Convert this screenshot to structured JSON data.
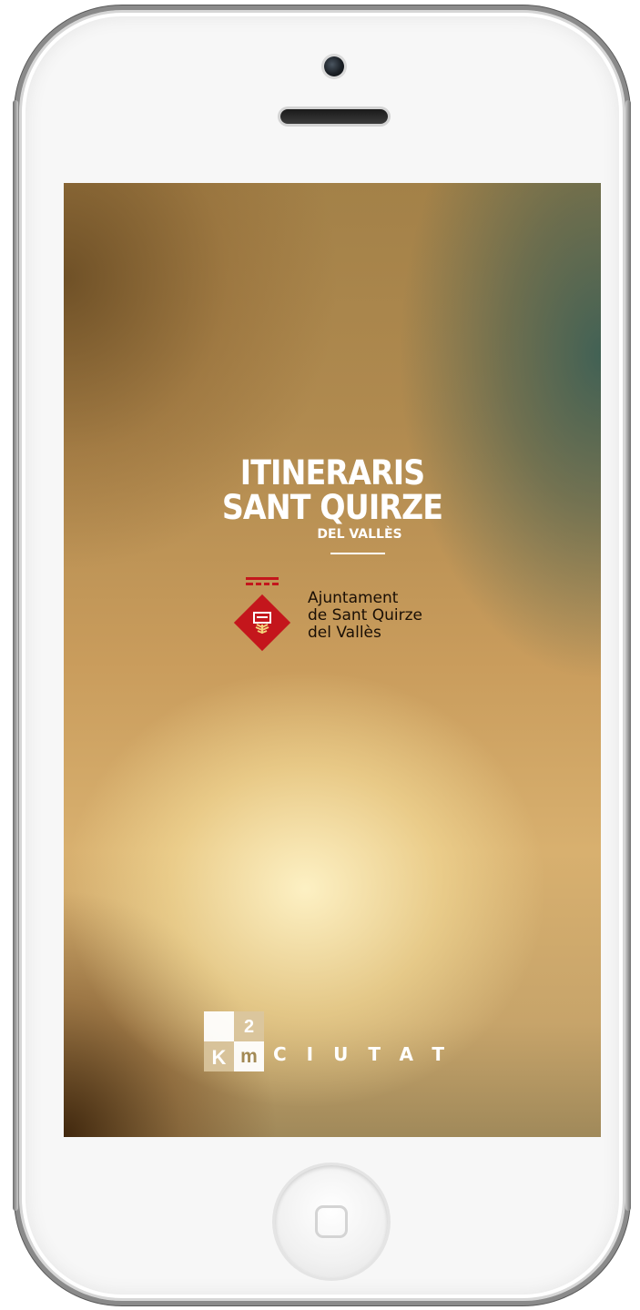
{
  "splash": {
    "title_line1": "ITINERARIS",
    "title_line2": "SANT QUIRZE",
    "title_line3": "DEL VALLÈS"
  },
  "council_logo": {
    "line1": "Ajuntament",
    "line2": "de Sant Quirze",
    "line3": "del Vallès",
    "brand_color": "#c4161c"
  },
  "partner_logo": {
    "superscript": "2",
    "k": "K",
    "m": "m",
    "name": "CIUTAT"
  },
  "device": {
    "camera_icon": "front-camera",
    "speaker_icon": "earpiece-speaker",
    "home_icon": "home-button"
  }
}
